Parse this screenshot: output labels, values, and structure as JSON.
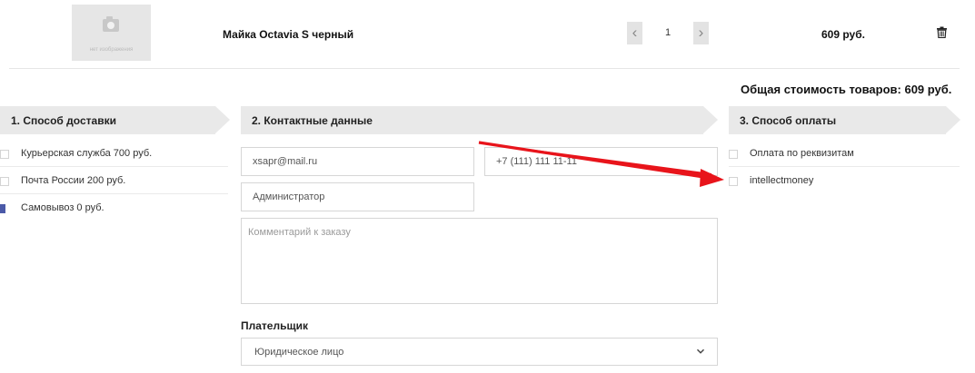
{
  "product": {
    "noimage_text": "нет изображения",
    "name": "Майка Octavia S черный",
    "quantity": "1",
    "dec_symbol": "‹",
    "inc_symbol": "›",
    "price": "609 руб."
  },
  "summary": {
    "total": "Общая стоимость товаров: 609  руб."
  },
  "delivery": {
    "title": "1. Способ доставки",
    "options": [
      {
        "label": "Курьерская служба  700 руб.",
        "checked": false
      },
      {
        "label": "Почта России  200 руб.",
        "checked": false
      },
      {
        "label": "Самовывоз  0 руб.",
        "checked": true
      }
    ]
  },
  "contacts": {
    "title": "2. Контактные данные",
    "email_value": "xsapr@mail.ru",
    "phone_value": "+7 (111) 111 11-11",
    "name_value": "Администратор",
    "comment_placeholder": "Комментарий к заказу",
    "payer_label": "Плательщик",
    "payer_selected": "Юридическое лицо"
  },
  "payment": {
    "title": "3. Способ оплаты",
    "options": [
      {
        "label": "Оплата по реквизитам",
        "checked": false
      },
      {
        "label": "intellectmoney",
        "checked": false
      }
    ]
  },
  "colors": {
    "annotation_arrow": "#e8141b",
    "checked_box": "#4b5aa8",
    "section_bg": "#e9e9e9"
  },
  "icons": {
    "image": "camera-icon",
    "delete": "trash-icon",
    "select": "chevron-down-icon"
  }
}
